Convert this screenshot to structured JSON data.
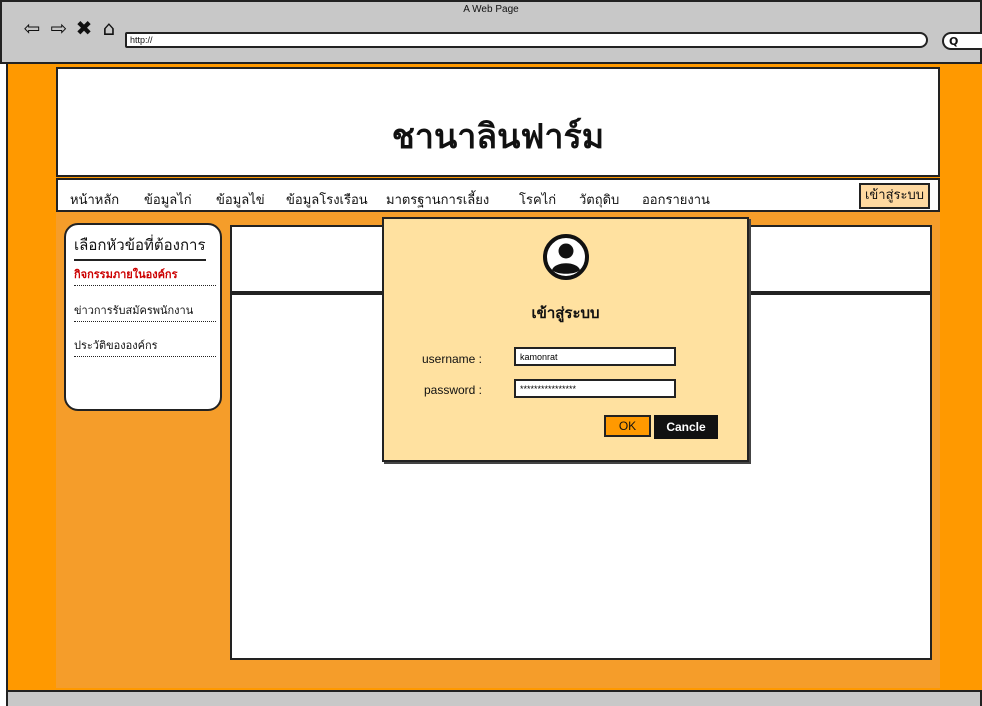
{
  "browser": {
    "title": "A Web Page",
    "url": "http://"
  },
  "header": {
    "site_title": "ชานาลินฟาร์ม"
  },
  "menu": {
    "items": [
      {
        "label": "หน้าหลัก"
      },
      {
        "label": "ข้อมูลไก่"
      },
      {
        "label": "ข้อมูลไข่"
      },
      {
        "label": "ข้อมูลโรงเรือน"
      },
      {
        "label": "มาตรฐานการเลี้ยง"
      },
      {
        "label": "โรคไก่"
      },
      {
        "label": "วัตถุดิบ"
      },
      {
        "label": "ออกรายงาน"
      }
    ],
    "login_label": "เข้าสู่ระบบ"
  },
  "sidebar": {
    "heading": "เลือกหัวข้อที่ต้องการ",
    "items": [
      {
        "label": "กิจกรรมภายในองค์กร",
        "active": true
      },
      {
        "label": "ข่าวการรับสมัครพนักงาน"
      },
      {
        "label": "ประวัติขององค์กร"
      }
    ]
  },
  "login_dialog": {
    "title": "เข้าสู่ระบบ",
    "username_label": "username :",
    "username_value": "kamonrat",
    "password_label": "password :",
    "password_value": "****************",
    "ok_label": "OK",
    "cancel_label": "Cancle"
  },
  "colors": {
    "page_background": "#ff9900",
    "dialog_background": "#ffe1a0",
    "active_link": "#cc0000",
    "login_button": "#ffd9a0"
  }
}
